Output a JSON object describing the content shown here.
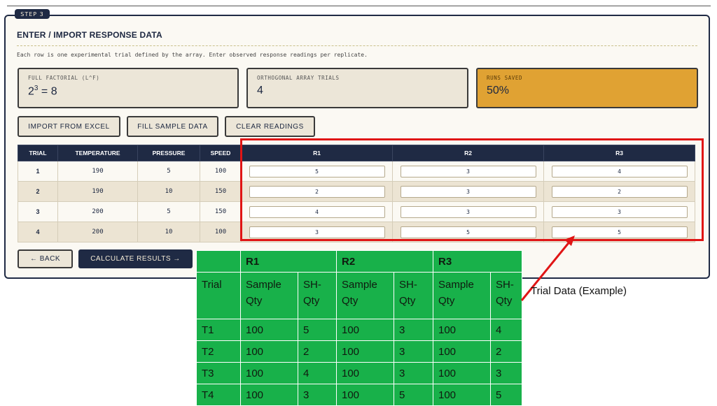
{
  "step": "STEP 3",
  "section": {
    "title": "ENTER / IMPORT RESPONSE DATA",
    "description": "Each row is one experimental trial defined by the array. Enter observed response readings per replicate."
  },
  "stats": {
    "full_factorial": {
      "label": "FULL FACTORIAL (L^F)",
      "base": "2",
      "exp": "3",
      "rest": " = 8"
    },
    "orthogonal": {
      "label": "ORTHOGONAL ARRAY TRIALS",
      "value": "4"
    },
    "runs_saved": {
      "label": "RUNS SAVED",
      "value": "50%"
    }
  },
  "buttons": {
    "import": "IMPORT FROM EXCEL",
    "fill": "FILL SAMPLE DATA",
    "clear": "CLEAR READINGS",
    "back": "← BACK",
    "calculate": "CALCULATE RESULTS →"
  },
  "trial_table": {
    "headers": [
      "TRIAL",
      "TEMPERATURE",
      "PRESSURE",
      "SPEED",
      "R1",
      "R2",
      "R3"
    ],
    "rows": [
      {
        "trial": "1",
        "temperature": "190",
        "pressure": "5",
        "speed": "100",
        "r1": "5",
        "r2": "3",
        "r3": "4"
      },
      {
        "trial": "2",
        "temperature": "190",
        "pressure": "10",
        "speed": "150",
        "r1": "2",
        "r2": "3",
        "r3": "2"
      },
      {
        "trial": "3",
        "temperature": "200",
        "pressure": "5",
        "speed": "150",
        "r1": "4",
        "r2": "3",
        "r3": "3"
      },
      {
        "trial": "4",
        "temperature": "200",
        "pressure": "10",
        "speed": "100",
        "r1": "3",
        "r2": "5",
        "r3": "5"
      }
    ]
  },
  "example_table": {
    "groups": [
      "R1",
      "R2",
      "R3"
    ],
    "trial_header": "Trial",
    "sample_qty_header": "Sample Qty",
    "sh_qty_header": "SH-Qty",
    "rows": [
      {
        "trial": "T1",
        "s1": "100",
        "q1": "5",
        "s2": "100",
        "q2": "3",
        "s3": "100",
        "q3": "4"
      },
      {
        "trial": "T2",
        "s1": "100",
        "q1": "2",
        "s2": "100",
        "q2": "3",
        "s3": "100",
        "q3": "2"
      },
      {
        "trial": "T3",
        "s1": "100",
        "q1": "4",
        "s2": "100",
        "q2": "3",
        "s3": "100",
        "q3": "3"
      },
      {
        "trial": "T4",
        "s1": "100",
        "q1": "3",
        "s2": "100",
        "q2": "5",
        "s3": "100",
        "q3": "5"
      }
    ]
  },
  "caption": "Trial Data (Example)",
  "colors": {
    "navy": "#1f2a44",
    "accent": "#e0a233",
    "highlight": "#e01515",
    "example_green": "#18b14a"
  }
}
